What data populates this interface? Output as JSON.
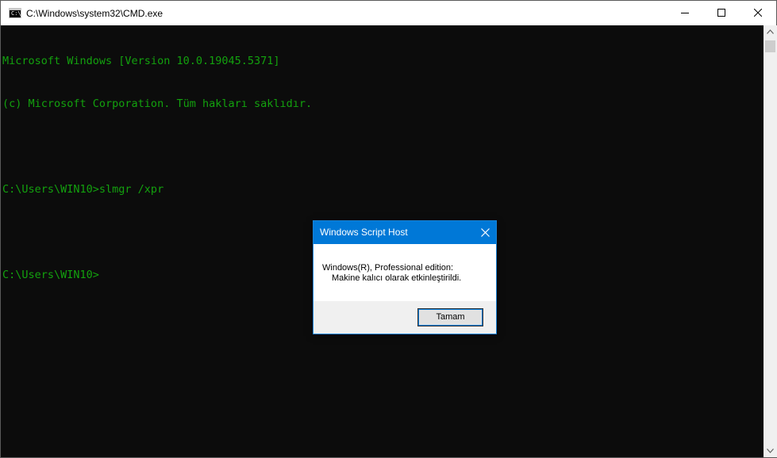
{
  "window": {
    "title": "C:\\Windows\\system32\\CMD.exe",
    "icon_label": "C:\\_"
  },
  "console": {
    "lines": [
      "Microsoft Windows [Version 10.0.19045.5371]",
      "(c) Microsoft Corporation. Tüm hakları saklıdır.",
      "",
      "C:\\Users\\WIN10>slmgr /xpr",
      "",
      "C:\\Users\\WIN10>"
    ],
    "text_color": "#13a10e",
    "background": "#0c0c0c"
  },
  "dialog": {
    "title": "Windows Script Host",
    "message_line1": "Windows(R), Professional edition:",
    "message_line2": "Makine kalıcı olarak etkinleştirildi.",
    "ok_label": "Tamam",
    "accent": "#0078d7"
  },
  "icons": {
    "app": "cmd-icon",
    "minimize": "minimize-icon",
    "maximize": "maximize-icon",
    "close": "close-icon",
    "dialog_close": "close-icon",
    "scroll_up": "chevron-up-icon",
    "scroll_down": "chevron-down-icon"
  }
}
